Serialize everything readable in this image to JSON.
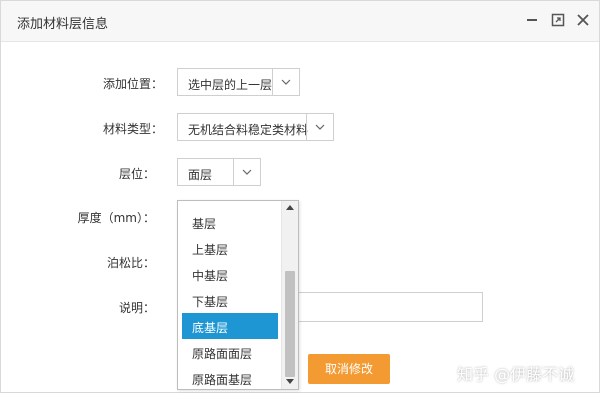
{
  "dialog": {
    "title": "添加材料层信息"
  },
  "form": {
    "position_label": "添加位置：",
    "position_value": "选中层的上一层",
    "material_type_label": "材料类型：",
    "material_type_value": "无机结合料稳定类材料",
    "layer_label": "层位：",
    "layer_value": "面层",
    "thickness_label": "厚度（mm）：",
    "poisson_label": "泊松比：",
    "description_label": "说明："
  },
  "layer_dropdown": {
    "options": [
      "基层",
      "上基层",
      "中基层",
      "下基层",
      "底基层",
      "原路面面层",
      "原路面基层"
    ],
    "selected": "底基层"
  },
  "buttons": {
    "cancel": "取消修改"
  },
  "watermark": "知乎 @伊藤不诚",
  "colors": {
    "accent": "#1e96d3",
    "cancel_button": "#f39a33"
  }
}
